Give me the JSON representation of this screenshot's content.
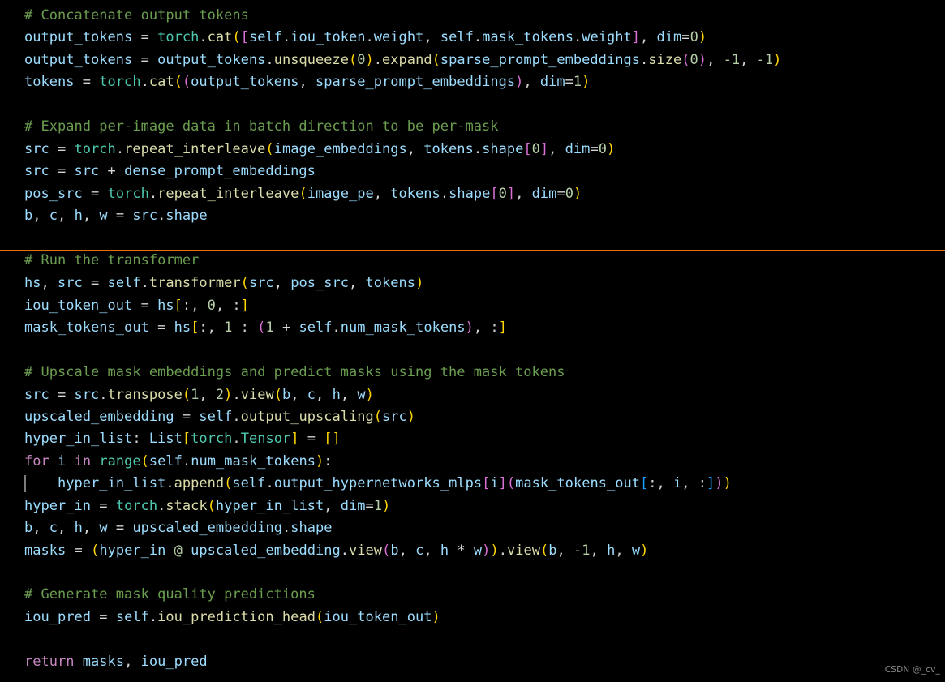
{
  "editor": {
    "background_color": "#000000",
    "highlight_border_color": "#e8700a",
    "font_size_px": 17,
    "line_height_px": 27.45,
    "colors": {
      "comment": "#6a9d4f",
      "identifier": "#9cdcfe",
      "type": "#4ec9b0",
      "function": "#dcdcaa",
      "keyword": "#c586c0",
      "number": "#b5cea8",
      "operator": "#d4d4d4",
      "bracket_0": "#ffd700",
      "bracket_1": "#da70d6",
      "bracket_2": "#179fff"
    }
  },
  "watermark": {
    "text": "CSDN @_cv_"
  },
  "code": {
    "lines": [
      {
        "n": 1,
        "text": "# Concatenate output tokens"
      },
      {
        "n": 2,
        "text": "output_tokens = torch.cat([self.iou_token.weight, self.mask_tokens.weight], dim=0)"
      },
      {
        "n": 3,
        "text": "output_tokens = output_tokens.unsqueeze(0).expand(sparse_prompt_embeddings.size(0), -1, -1)"
      },
      {
        "n": 4,
        "text": "tokens = torch.cat((output_tokens, sparse_prompt_embeddings), dim=1)"
      },
      {
        "n": 5,
        "text": ""
      },
      {
        "n": 6,
        "text": "# Expand per-image data in batch direction to be per-mask"
      },
      {
        "n": 7,
        "text": "src = torch.repeat_interleave(image_embeddings, tokens.shape[0], dim=0)"
      },
      {
        "n": 8,
        "text": "src = src + dense_prompt_embeddings"
      },
      {
        "n": 9,
        "text": "pos_src = torch.repeat_interleave(image_pe, tokens.shape[0], dim=0)"
      },
      {
        "n": 10,
        "text": "b, c, h, w = src.shape"
      },
      {
        "n": 11,
        "text": ""
      },
      {
        "n": 12,
        "text": "# Run the transformer"
      },
      {
        "n": 13,
        "text": "hs, src = self.transformer(src, pos_src, tokens)"
      },
      {
        "n": 14,
        "text": "iou_token_out = hs[:, 0, :]"
      },
      {
        "n": 15,
        "text": "mask_tokens_out = hs[:, 1 : (1 + self.num_mask_tokens), :]"
      },
      {
        "n": 16,
        "text": ""
      },
      {
        "n": 17,
        "text": "# Upscale mask embeddings and predict masks using the mask tokens"
      },
      {
        "n": 18,
        "text": "src = src.transpose(1, 2).view(b, c, h, w)"
      },
      {
        "n": 19,
        "text": "upscaled_embedding = self.output_upscaling(src)"
      },
      {
        "n": 20,
        "text": "hyper_in_list: List[torch.Tensor] = []"
      },
      {
        "n": 21,
        "text": "for i in range(self.num_mask_tokens):"
      },
      {
        "n": 22,
        "text": "    hyper_in_list.append(self.output_hypernetworks_mlps[i](mask_tokens_out[:, i, :]))"
      },
      {
        "n": 23,
        "text": "hyper_in = torch.stack(hyper_in_list, dim=1)"
      },
      {
        "n": 24,
        "text": "b, c, h, w = upscaled_embedding.shape"
      },
      {
        "n": 25,
        "text": "masks = (hyper_in @ upscaled_embedding.view(b, c, h * w)).view(b, -1, h, w)"
      },
      {
        "n": 26,
        "text": ""
      },
      {
        "n": 27,
        "text": "# Generate mask quality predictions"
      },
      {
        "n": 28,
        "text": "iou_pred = self.iou_prediction_head(iou_token_out)"
      },
      {
        "n": 29,
        "text": ""
      },
      {
        "n": 30,
        "text": "return masks, iou_pred"
      }
    ],
    "highlighted_line": 12,
    "caret_line": 22
  }
}
